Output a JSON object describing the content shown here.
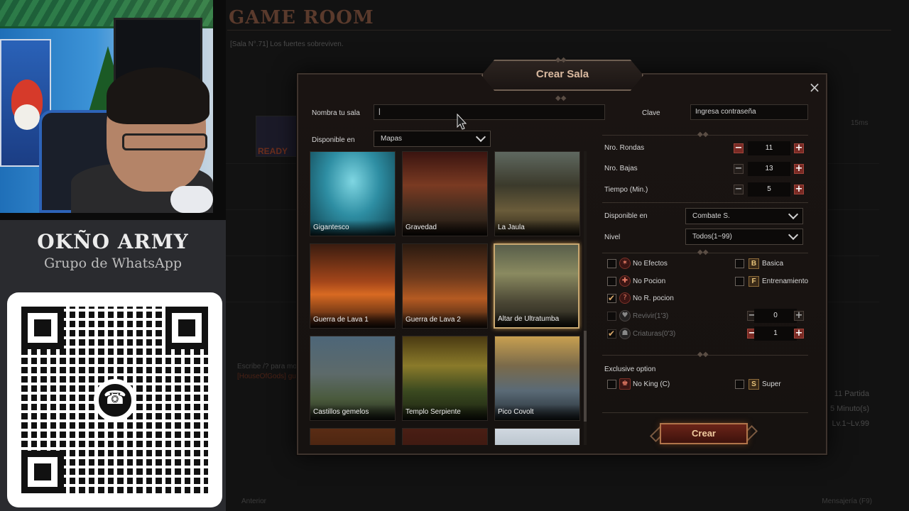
{
  "overlay": {
    "brand_title": "OKÑO ARMY",
    "brand_subtitle": "Grupo de WhatsApp"
  },
  "background": {
    "title": "GAME ROOM",
    "room_line": "[Sala N°.71] Los fuertes sobreviven.",
    "ready_label": "READY",
    "ping": "15ms",
    "chat_hint": "Escribe /? para mos",
    "chat_user": "[HouseOfGods] gu",
    "stats": [
      "11 Partida",
      "5 Minuto(s)",
      "Lv.1~Lv.99"
    ],
    "prev_label": "Anterior",
    "messages_label": "Mensajería (F9)"
  },
  "dialog": {
    "title": "Crear Sala",
    "room_name_label": "Nombra tu sala",
    "room_name_value": "",
    "password_label": "Clave",
    "password_placeholder": "Ingresa contraseña",
    "available_label": "Disponible en",
    "available_value": "Mapas",
    "maps": [
      {
        "name": "Gigantesco",
        "art": "gig",
        "selected": false
      },
      {
        "name": "Gravedad",
        "art": "gra",
        "selected": false
      },
      {
        "name": "La Jaula",
        "art": "jau",
        "selected": false
      },
      {
        "name": "Guerra de Lava 1",
        "art": "lava1",
        "selected": false
      },
      {
        "name": "Guerra de Lava 2",
        "art": "lava2",
        "selected": false
      },
      {
        "name": "Altar de Ultratumba",
        "art": "altar",
        "selected": true
      },
      {
        "name": "Castillos gemelos",
        "art": "cast",
        "selected": false
      },
      {
        "name": "Templo Serpiente",
        "art": "temp",
        "selected": false
      },
      {
        "name": "Pico Covolt",
        "art": "pico",
        "selected": false
      }
    ],
    "settings": {
      "rounds_label": "Nro. Rondas",
      "rounds_value": "11",
      "kills_label": "Nro. Bajas",
      "kills_value": "13",
      "time_label": "Tiempo (Min.)",
      "time_value": "5",
      "mode_label": "Disponible en",
      "mode_value": "Combate S.",
      "level_label": "Nivel",
      "level_value": "Todos(1~99)"
    },
    "options": {
      "no_effects": "No Efectos",
      "no_potion": "No Pocion",
      "no_r_potion": "No R. pocion",
      "revive": "Revivir(1'3)",
      "creatures": "Criaturas(0'3)",
      "basic": "Basica",
      "training": "Entrenamiento",
      "revive_value": "0",
      "creatures_value": "1",
      "letter_basic": "B",
      "letter_training": "F",
      "letter_super": "S"
    },
    "exclusive_label": "Exclusive option",
    "no_king": "No King (C)",
    "super": "Super",
    "create_button": "Crear",
    "close_icon": "×"
  }
}
